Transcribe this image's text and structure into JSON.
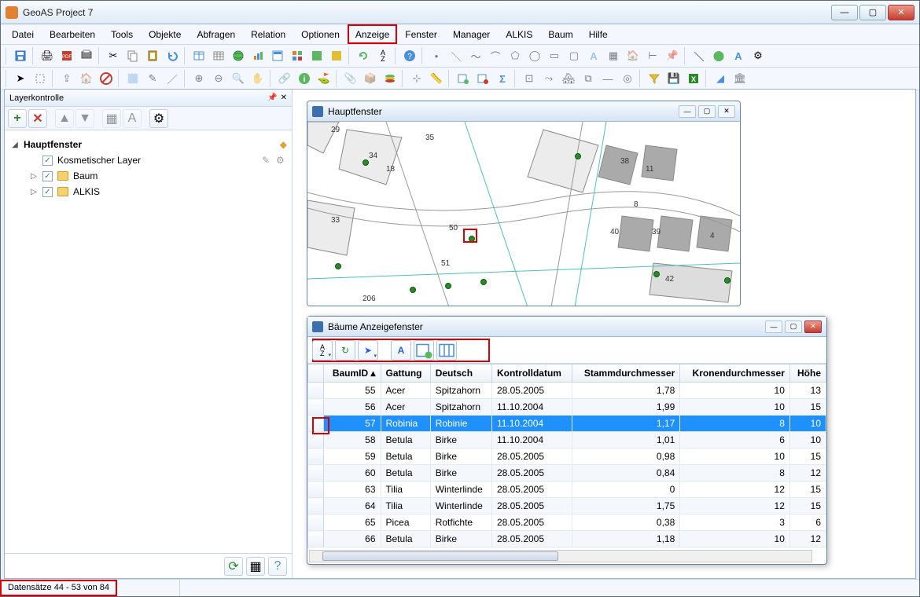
{
  "app": {
    "title": "GeoAS Project 7"
  },
  "menu": {
    "items": [
      "Datei",
      "Bearbeiten",
      "Tools",
      "Objekte",
      "Abfragen",
      "Relation",
      "Optionen",
      "Anzeige",
      "Fenster",
      "Manager",
      "ALKIS",
      "Baum",
      "Hilfe"
    ],
    "highlighted_index": 7
  },
  "layerpanel": {
    "title": "Layerkontrolle",
    "root": "Hauptfenster",
    "items": [
      {
        "label": "Kosmetischer Layer",
        "checked": true,
        "folder": false
      },
      {
        "label": "Baum",
        "checked": true,
        "folder": true,
        "expandable": true
      },
      {
        "label": "ALKIS",
        "checked": true,
        "folder": true,
        "expandable": true
      }
    ]
  },
  "mapwin": {
    "title": "Hauptfenster",
    "house_numbers": [
      "29",
      "35",
      "34",
      "18",
      "38",
      "11",
      "33",
      "8",
      "50",
      "40",
      "39",
      "4",
      "51",
      "42",
      "206"
    ]
  },
  "datawin": {
    "title": "Bäume Anzeigefenster",
    "columns": [
      "BaumID",
      "Gattung",
      "Deutsch",
      "Kontrolldatum",
      "Stammdurchmesser",
      "Kronendurchmesser",
      "Höhe"
    ],
    "selected_row": 2,
    "rows": [
      {
        "id": "55",
        "g": "Acer",
        "d": "Spitzahorn",
        "k": "28.05.2005",
        "s": "1,78",
        "kr": "10",
        "h": "13"
      },
      {
        "id": "56",
        "g": "Acer",
        "d": "Spitzahorn",
        "k": "11.10.2004",
        "s": "1,99",
        "kr": "10",
        "h": "15"
      },
      {
        "id": "57",
        "g": "Robinia",
        "d": "Robinie",
        "k": "11.10.2004",
        "s": "1,17",
        "kr": "8",
        "h": "10"
      },
      {
        "id": "58",
        "g": "Betula",
        "d": "Birke",
        "k": "11.10.2004",
        "s": "1,01",
        "kr": "6",
        "h": "10"
      },
      {
        "id": "59",
        "g": "Betula",
        "d": "Birke",
        "k": "28.05.2005",
        "s": "0,98",
        "kr": "10",
        "h": "15"
      },
      {
        "id": "60",
        "g": "Betula",
        "d": "Birke",
        "k": "28.05.2005",
        "s": "0,84",
        "kr": "8",
        "h": "12"
      },
      {
        "id": "63",
        "g": "Tilia",
        "d": "Winterlinde",
        "k": "28.05.2005",
        "s": "0",
        "kr": "12",
        "h": "15"
      },
      {
        "id": "64",
        "g": "Tilia",
        "d": "Winterlinde",
        "k": "28.05.2005",
        "s": "1,75",
        "kr": "12",
        "h": "15"
      },
      {
        "id": "65",
        "g": "Picea",
        "d": "Rotfichte",
        "k": "28.05.2005",
        "s": "0,38",
        "kr": "3",
        "h": "6"
      },
      {
        "id": "66",
        "g": "Betula",
        "d": "Birke",
        "k": "28.05.2005",
        "s": "1,18",
        "kr": "10",
        "h": "12"
      }
    ]
  },
  "statusbar": {
    "records": "Datensätze 44 - 53 von 84"
  }
}
